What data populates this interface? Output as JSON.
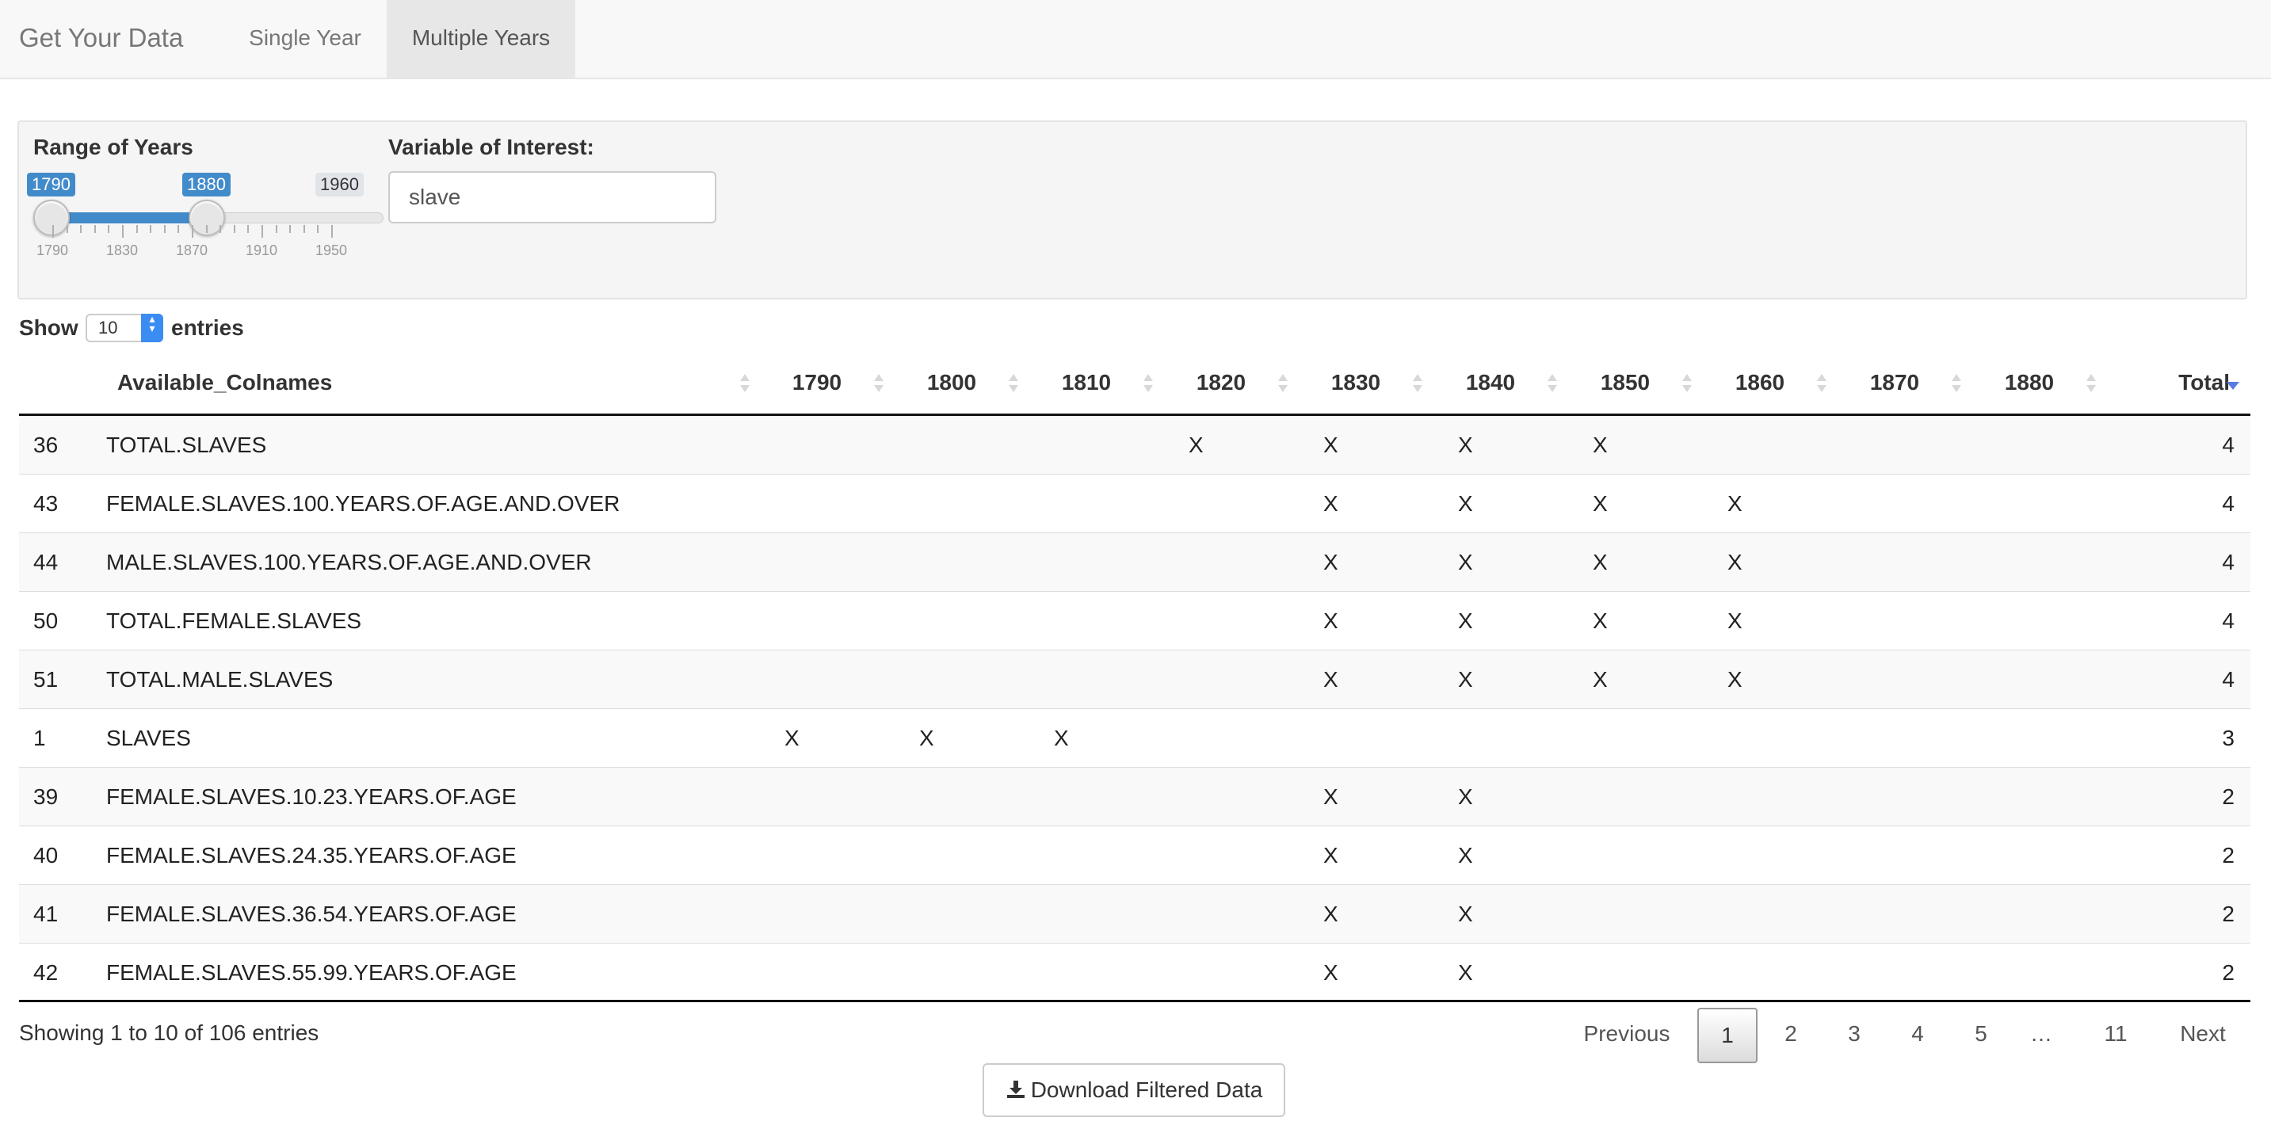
{
  "nav": {
    "brand": "Get Your Data",
    "tabs": [
      {
        "label": "Single Year",
        "active": false
      },
      {
        "label": "Multiple Years",
        "active": true
      }
    ]
  },
  "controls": {
    "range_label": "Range of Years",
    "range": {
      "min": 1790,
      "max": 1960,
      "from": "1790",
      "to": "1880",
      "max_label": "1960",
      "tick_labels": [
        "1790",
        "1830",
        "1870",
        "1910",
        "1950"
      ]
    },
    "variable_label": "Variable of Interest:",
    "variable_value": "slave"
  },
  "length": {
    "show": "Show",
    "value": "10",
    "entries": "entries"
  },
  "table": {
    "columns": [
      "",
      "Available_Colnames",
      "1790",
      "1800",
      "1810",
      "1820",
      "1830",
      "1840",
      "1850",
      "1860",
      "1870",
      "1880",
      "Total"
    ],
    "rows": [
      [
        "36",
        "TOTAL.SLAVES",
        "",
        "",
        "",
        "X",
        "X",
        "X",
        "X",
        "",
        "",
        "",
        "4"
      ],
      [
        "43",
        "FEMALE.SLAVES.100.YEARS.OF.AGE.AND.OVER",
        "",
        "",
        "",
        "",
        "X",
        "X",
        "X",
        "X",
        "",
        "",
        "4"
      ],
      [
        "44",
        "MALE.SLAVES.100.YEARS.OF.AGE.AND.OVER",
        "",
        "",
        "",
        "",
        "X",
        "X",
        "X",
        "X",
        "",
        "",
        "4"
      ],
      [
        "50",
        "TOTAL.FEMALE.SLAVES",
        "",
        "",
        "",
        "",
        "X",
        "X",
        "X",
        "X",
        "",
        "",
        "4"
      ],
      [
        "51",
        "TOTAL.MALE.SLAVES",
        "",
        "",
        "",
        "",
        "X",
        "X",
        "X",
        "X",
        "",
        "",
        "4"
      ],
      [
        "1",
        "SLAVES",
        "X",
        "X",
        "X",
        "",
        "",
        "",
        "",
        "",
        "",
        "",
        "3"
      ],
      [
        "39",
        "FEMALE.SLAVES.10.23.YEARS.OF.AGE",
        "",
        "",
        "",
        "",
        "X",
        "X",
        "",
        "",
        "",
        "",
        "2"
      ],
      [
        "40",
        "FEMALE.SLAVES.24.35.YEARS.OF.AGE",
        "",
        "",
        "",
        "",
        "X",
        "X",
        "",
        "",
        "",
        "",
        "2"
      ],
      [
        "41",
        "FEMALE.SLAVES.36.54.YEARS.OF.AGE",
        "",
        "",
        "",
        "",
        "X",
        "X",
        "",
        "",
        "",
        "",
        "2"
      ],
      [
        "42",
        "FEMALE.SLAVES.55.99.YEARS.OF.AGE",
        "",
        "",
        "",
        "",
        "X",
        "X",
        "",
        "",
        "",
        "",
        "2"
      ]
    ]
  },
  "footer": {
    "info": "Showing 1 to 10 of 106 entries",
    "pagination": [
      "Previous",
      "1",
      "2",
      "3",
      "4",
      "5",
      "…",
      "11",
      "Next"
    ],
    "current_page": "1",
    "download_label": "Download Filtered Data"
  },
  "colors": {
    "accent": "#428bca",
    "sort_active": "#5b7be0"
  }
}
